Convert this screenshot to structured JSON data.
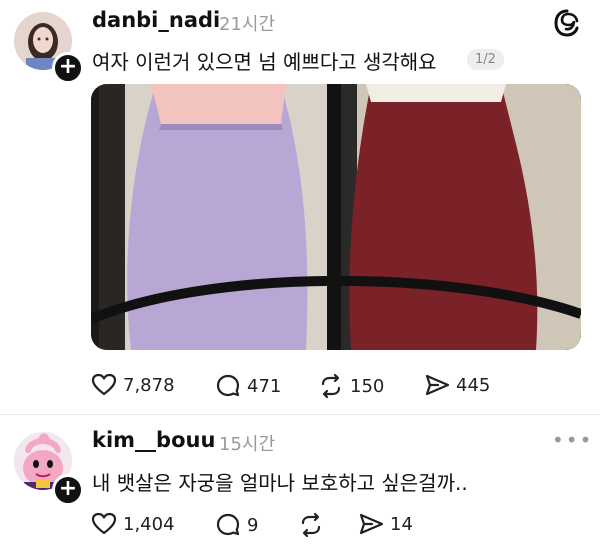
{
  "posts": [
    {
      "username": "danbi_nadi",
      "time": "21시간",
      "text": "여자 이런거 있으면 넘 예쁘다고 생각해요",
      "page_indicator": "1/2",
      "likes": "7,878",
      "comments": "471",
      "reposts": "150",
      "shares": "445"
    },
    {
      "username": "kim__bouu",
      "time": "15시간",
      "text": "내 뱃살은 자궁을 얼마나 보호하고 싶은걸까..",
      "likes": "1,404",
      "comments": "9",
      "reposts": "",
      "shares": "14"
    }
  ],
  "colors": {
    "text": "#111111",
    "muted": "#9a9a9a",
    "lavender_skirt": "#b8a6d4",
    "maroon_skirt": "#7a2228"
  },
  "icons": [
    "threads-logo-icon",
    "heart-icon",
    "comment-icon",
    "repost-icon",
    "share-icon",
    "more-icon",
    "plus-icon"
  ]
}
